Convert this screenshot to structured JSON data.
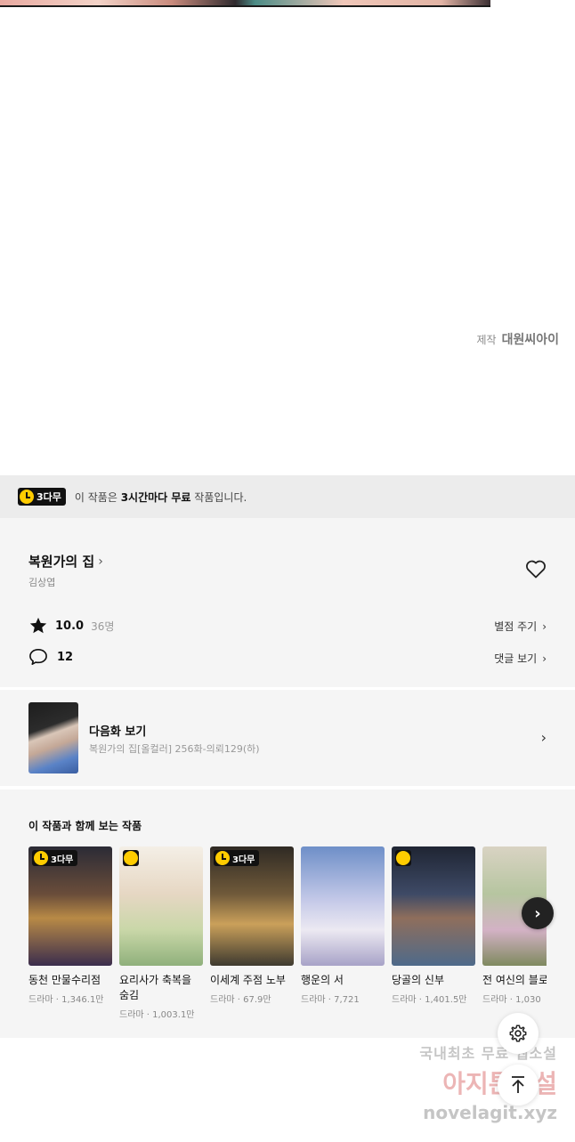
{
  "credit": {
    "prefix": "제작",
    "studio": "대원씨아이"
  },
  "free_banner": {
    "badge": "3다무",
    "text_before": "이 작품은 ",
    "text_bold": "3시간마다 무료",
    "text_after": " 작품입니다."
  },
  "work": {
    "title": "복원가의 집",
    "author": "김상엽",
    "rating": "10.0",
    "rating_count": "36명",
    "comment_count": "12",
    "rate_link": "별점 주기",
    "comment_link": "댓글 보기"
  },
  "next_episode": {
    "label": "다음화 보기",
    "subtitle": "복원가의 집[올컬러] 256화-의뢰129(하)"
  },
  "recommendations": {
    "title": "이 작품과 함께 보는 작품",
    "items": [
      {
        "name": "동천 만물수리점",
        "meta": "드라마 · 1,346.1만",
        "badge": "3다무"
      },
      {
        "name": "요리사가 축복을 숨김",
        "meta": "드라마 · 1,003.1만",
        "badge": "clock"
      },
      {
        "name": "이세계 주점 노부",
        "meta": "드라마 · 67.9만",
        "badge": "3다무"
      },
      {
        "name": "행운의 서",
        "meta": "드라마 · 7,721",
        "badge": ""
      },
      {
        "name": "당골의 신부",
        "meta": "드라마 · 1,401.5만",
        "badge": "clock"
      },
      {
        "name": "전 여신의 블로",
        "meta": "드라마 · 1,030",
        "badge": ""
      }
    ]
  },
  "watermark": {
    "line1": "국내최초 무료 웹소설",
    "line2": "아지툰소설",
    "line3": "novelagit.xyz"
  }
}
